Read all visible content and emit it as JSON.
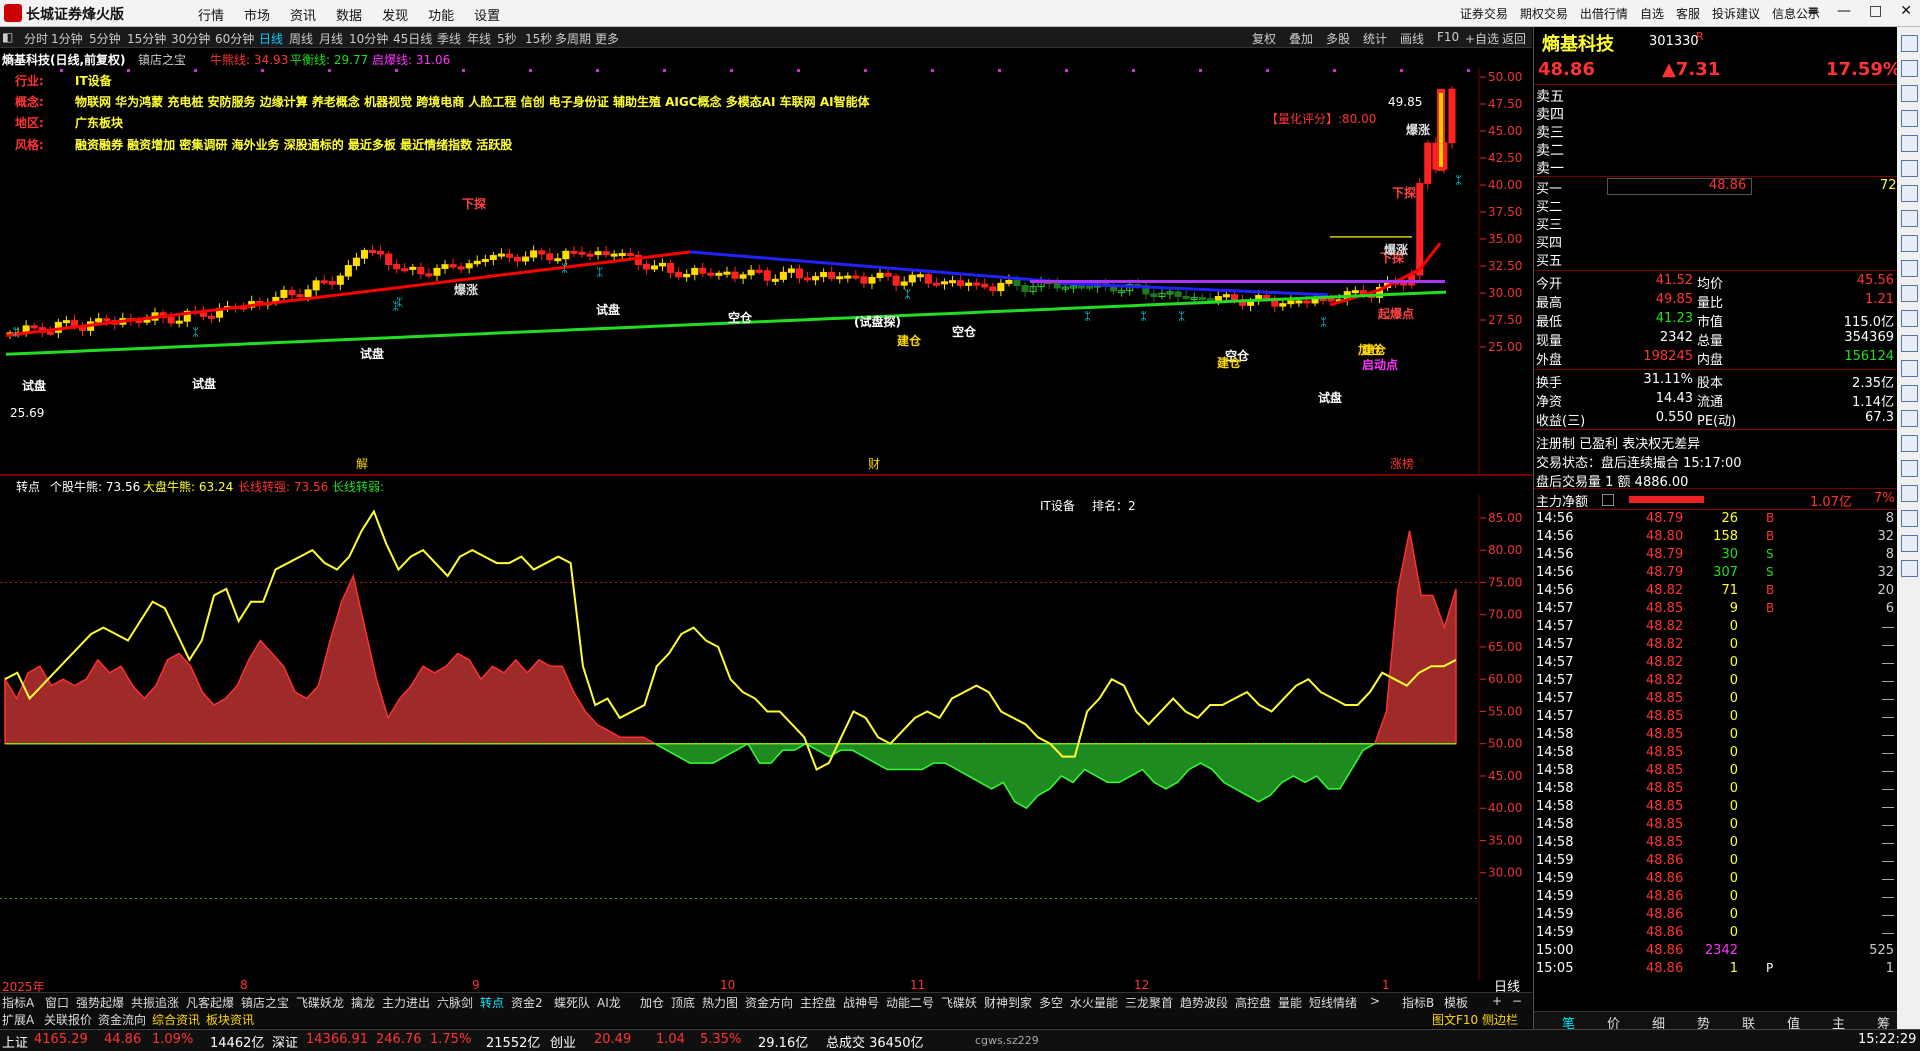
{
  "app": {
    "title": "长城证券烽火版"
  },
  "menu": [
    "行情",
    "市场",
    "资讯",
    "数据",
    "发现",
    "功能",
    "设置"
  ],
  "right_menu": [
    "证券交易",
    "期权交易",
    "出借行情",
    "自选",
    "客服",
    "投诉建议",
    "信息公示"
  ],
  "periods": [
    "分时",
    "1分钟",
    "5分钟",
    "15分钟",
    "30分钟",
    "60分钟",
    "日线",
    "周线",
    "月线",
    "10分钟",
    "45日线",
    "季线",
    "年线",
    "5秒",
    "15秒",
    "多周期",
    "更多"
  ],
  "active_period": "日线",
  "chart_toolbar": [
    "复权",
    "叠加",
    "多股",
    "统计",
    "画线",
    "F10",
    "+自选",
    "返回"
  ],
  "stock": {
    "name": "熵基科技",
    "code": "301330",
    "suffix": "R",
    "price": "48.86",
    "change": "▲7.31",
    "pct": "17.59%"
  },
  "main_chart": {
    "header_name": "熵基科技(日线,前复权)",
    "indicator": "镇店之宝",
    "bull_label": "牛熊线: 34.93",
    "balance_label": "平衡线: 29.77",
    "start_label": "启爆线: 31.06",
    "info": [
      {
        "k": "行业:",
        "v": "IT设备"
      },
      {
        "k": "概念:",
        "v": "物联网 华为鸿蒙 充电桩 安防服务 边缘计算 养老概念 机器视觉 跨境电商 人脸工程 信创 电子身份证 辅助生殖 AIGC概念 多模态AI 车联网 AI智能体"
      },
      {
        "k": "地区:",
        "v": "广东板块"
      },
      {
        "k": "风格:",
        "v": "融资融券 融资增加 密集调研 海外业务 深股通标的 最近多板 最近情绪指数 活跃股"
      }
    ],
    "score_label": "【量化评分】:80.00",
    "high_label": "49.85",
    "y_ticks": [
      "50.00",
      "47.50",
      "45.00",
      "42.50",
      "40.00",
      "37.50",
      "35.00",
      "32.50",
      "30.00",
      "27.50",
      "25.00"
    ],
    "low_label": "25.69",
    "annotations": [
      "下探",
      "下探",
      "下探",
      "试盘",
      "试盘",
      "试盘",
      "试盘",
      "试盘",
      "空仓",
      "空仓",
      "空仓",
      "建仓",
      "建仓",
      "建仓",
      "加仓",
      "启动点",
      "爆涨",
      "爆涨",
      "爆涨",
      "(试盘探)",
      "起爆点"
    ],
    "markers": [
      "解",
      "财",
      "涨榜"
    ]
  },
  "sub_chart": {
    "title": "转点",
    "stock_bull": "个股牛熊: 73.56",
    "market_bull": "大盘牛熊: 63.24",
    "long_strong": "长线转强: 73.56",
    "long_weak": "长线转弱:",
    "center_text": "IT设备",
    "rank_text": "排名：2",
    "y_ticks": [
      "85.00",
      "80.00",
      "75.00",
      "70.00",
      "65.00",
      "60.00",
      "55.00",
      "50.00",
      "45.00",
      "40.00",
      "35.00",
      "30.00"
    ]
  },
  "date_axis": [
    "2025年",
    "8",
    "9",
    "10",
    "11",
    "12",
    "1"
  ],
  "tabs_row1": [
    "指标A",
    "窗口",
    "强势起爆",
    "共振追涨",
    "凡客起爆",
    "镇店之宝",
    "飞碟妖龙",
    "擒龙",
    "主力进出",
    "六脉剑",
    "转点",
    "资金2",
    "蝶死队",
    "AI龙",
    "加仓",
    "顶底",
    "热力图",
    "资金方向",
    "主控盘",
    "战神号",
    "动能二号",
    "飞碟妖",
    "财神到家",
    "多空",
    "水火量能",
    "三龙聚首",
    "趋势波段",
    "高控盘",
    "量能",
    "短线情绪"
  ],
  "tabs_row1_right": [
    "指标B",
    "模板"
  ],
  "tabs_row2": [
    "扩展A",
    "关联报价",
    "资金流向",
    "综合资讯",
    "板块资讯"
  ],
  "tabs_row2_right": "图文F10 侧边栏",
  "rpanel": {
    "sells": [
      "卖五",
      "卖四",
      "卖三",
      "卖二",
      "卖一"
    ],
    "buys": [
      {
        "l": "买一",
        "p": "48.86",
        "v": "72"
      },
      {
        "l": "买二",
        "p": "",
        "v": ""
      },
      {
        "l": "买三",
        "p": "",
        "v": ""
      },
      {
        "l": "买四",
        "p": "",
        "v": ""
      },
      {
        "l": "买五",
        "p": "",
        "v": ""
      }
    ],
    "stats": [
      [
        "今开",
        "41.52",
        "均价",
        "45.56"
      ],
      [
        "最高",
        "49.85",
        "量比",
        "1.21"
      ],
      [
        "最低",
        "41.23",
        "市值",
        "115.0亿"
      ],
      [
        "现量",
        "2342",
        "总量",
        "354369"
      ],
      [
        "外盘",
        "198245",
        "内盘",
        "156124"
      ],
      [
        "换手",
        "31.11%",
        "股本",
        "2.35亿"
      ],
      [
        "净资",
        "14.43",
        "流通",
        "1.14亿"
      ],
      [
        "收益(三)",
        "0.550",
        "PE(动)",
        "67.3"
      ]
    ],
    "regline": "注册制  已盈利  表决权无差异",
    "trade_state": "交易状态：盘后连续撮合 15:17:00",
    "after_trade": "盘后交易量 1 额 4886.00",
    "main_net_label": "主力净额",
    "main_net_val": "1.07亿",
    "main_net_pct": "7%",
    "ticks": [
      [
        "14:56",
        "48.79",
        "26",
        "B",
        "8"
      ],
      [
        "14:56",
        "48.80",
        "158",
        "B",
        "32"
      ],
      [
        "14:56",
        "48.79",
        "30",
        "S",
        "8"
      ],
      [
        "14:56",
        "48.79",
        "307",
        "S",
        "32"
      ],
      [
        "14:56",
        "48.82",
        "71",
        "B",
        "20"
      ],
      [
        "14:57",
        "48.85",
        "9",
        "B",
        "6"
      ],
      [
        "14:57",
        "48.82",
        "0",
        "",
        ""
      ],
      [
        "14:57",
        "48.82",
        "0",
        "",
        ""
      ],
      [
        "14:57",
        "48.82",
        "0",
        "",
        ""
      ],
      [
        "14:57",
        "48.82",
        "0",
        "",
        ""
      ],
      [
        "14:57",
        "48.85",
        "0",
        "",
        ""
      ],
      [
        "14:57",
        "48.85",
        "0",
        "",
        ""
      ],
      [
        "14:58",
        "48.85",
        "0",
        "",
        ""
      ],
      [
        "14:58",
        "48.85",
        "0",
        "",
        ""
      ],
      [
        "14:58",
        "48.85",
        "0",
        "",
        ""
      ],
      [
        "14:58",
        "48.85",
        "0",
        "",
        ""
      ],
      [
        "14:58",
        "48.85",
        "0",
        "",
        ""
      ],
      [
        "14:58",
        "48.85",
        "0",
        "",
        ""
      ],
      [
        "14:58",
        "48.85",
        "0",
        "",
        ""
      ],
      [
        "14:59",
        "48.86",
        "0",
        "",
        ""
      ],
      [
        "14:59",
        "48.86",
        "0",
        "",
        ""
      ],
      [
        "14:59",
        "48.86",
        "0",
        "",
        ""
      ],
      [
        "14:59",
        "48.86",
        "0",
        "",
        ""
      ],
      [
        "14:59",
        "48.86",
        "0",
        "",
        ""
      ],
      [
        "15:00",
        "48.86",
        "2342",
        "",
        "525"
      ],
      [
        "15:05",
        "48.86",
        "1",
        "P",
        "1"
      ]
    ],
    "bottom_tabs": [
      "笔",
      "价",
      "细",
      "势",
      "联",
      "值",
      "主",
      "筹"
    ]
  },
  "status": {
    "sh_label": "上证",
    "sh_val": "4165.29",
    "sh_chg": "44.86",
    "sh_pct": "1.09%",
    "sh_amt": "14462亿",
    "sz_label": "深证",
    "sz_val": "14366.91",
    "sz_chg": "246.76",
    "sz_pct": "1.75%",
    "sz_amt": "21552亿",
    "cy_label": "创业",
    "cy_val": "20.49",
    "cy_chg": "1.04",
    "cy_pct": "5.35%",
    "cy_amt": "29.16亿",
    "total": "总成交 36450亿",
    "server": "cgws.sz229",
    "time": "15:22:29"
  }
}
